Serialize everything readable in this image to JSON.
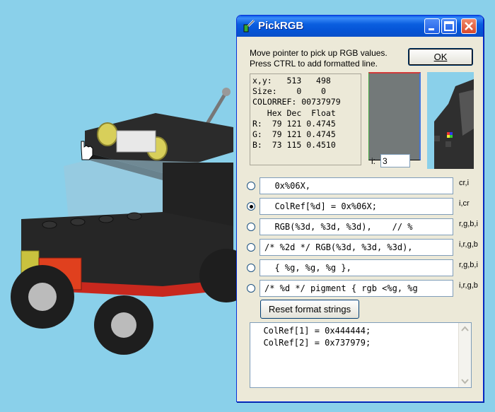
{
  "window": {
    "title": "PickRGB",
    "instruction_line1": "Move pointer to pick up RGB values.",
    "instruction_line2": "Press CTRL to add formatted line.",
    "ok_label": "OK"
  },
  "info": {
    "xy_label": "x,y:",
    "x": "513",
    "y": "498",
    "size_label": "Size:",
    "size_w": "0",
    "size_h": "0",
    "colorref_label": "COLORREF:",
    "colorref": "00737979",
    "header_hex": "Hex",
    "header_dec": "Dec",
    "header_float": "Float",
    "rows": [
      {
        "ch": "R:",
        "hex": "79",
        "dec": "121",
        "float": "0.4745"
      },
      {
        "ch": "G:",
        "hex": "79",
        "dec": "121",
        "float": "0.4745"
      },
      {
        "ch": "B:",
        "hex": "73",
        "dec": "115",
        "float": "0.4510"
      }
    ]
  },
  "swatch_color": "#737979",
  "zoom": {
    "label": "i:",
    "value": "3"
  },
  "formats": [
    {
      "text": "  0x%06X,",
      "args": "cr,i",
      "selected": false
    },
    {
      "text": "  ColRef[%d] = 0x%06X;",
      "args": "i,cr",
      "selected": true
    },
    {
      "text": "  RGB(%3d, %3d, %3d),    // %",
      "args": "r,g,b,i",
      "selected": false
    },
    {
      "text": "/* %2d */ RGB(%3d, %3d, %3d),",
      "args": "i,r,g,b",
      "selected": false
    },
    {
      "text": "  { %g, %g, %g },",
      "args": "r,g,b,i",
      "selected": false
    },
    {
      "text": "/* %d */ pigment { rgb <%g, %g",
      "args": "i,r,g,b",
      "selected": false
    }
  ],
  "reset_label": "Reset format strings",
  "output": {
    "line1": "  ColRef[1] = 0x444444;",
    "line2": "  ColRef[2] = 0x737979;"
  }
}
